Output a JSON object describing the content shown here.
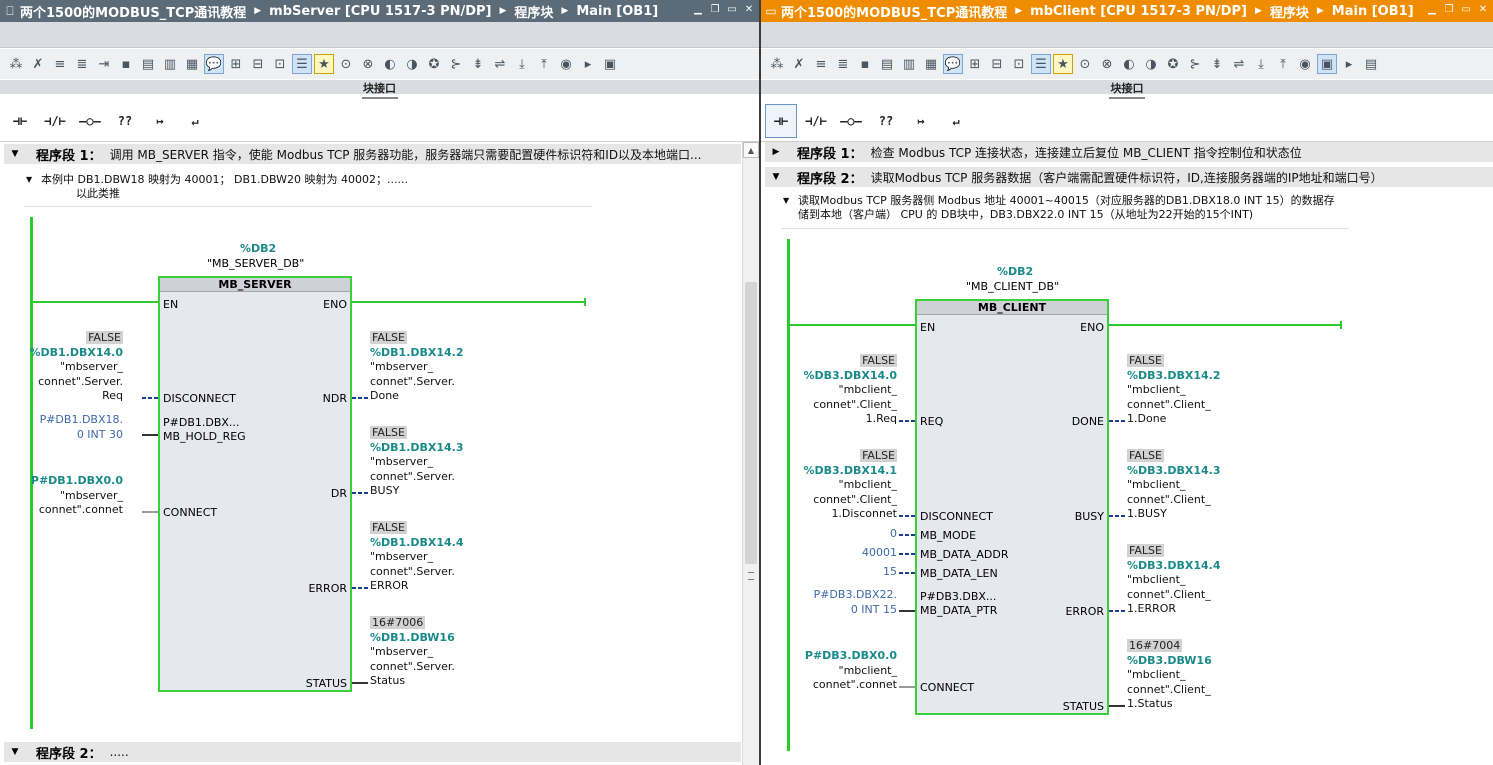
{
  "colors": {
    "left_title_bg": "#5b6b78",
    "right_title_bg": "#f08c00",
    "rail": "#2ccb2c",
    "block_border": "#39d039",
    "addr": "#1b8a8a",
    "const": "#3d6aa8"
  },
  "left": {
    "breadcrumb": [
      "两个1500的MODBUS_TCP通讯教程",
      "mbServer [CPU 1517-3 PN/DP]",
      "程序块",
      "Main [OB1]"
    ],
    "block_interface": "块接口",
    "favorites": [
      "⊣⊢",
      "⊣/⊢",
      "–○–",
      "??",
      "↦",
      "↵"
    ],
    "network1": {
      "title": "程序段 1：",
      "text": "调用 MB_SERVER 指令，使能 Modbus TCP 服务器功能，服务器端只需要配置硬件标识符和ID以及本地端口...",
      "comment_line1": "本例中 DB1.DBW18 映射为 40001； DB1.DBW20 映射为 40002；......",
      "comment_line2": "以此类推"
    },
    "block": {
      "db_addr": "%DB2",
      "db_name": "\"MB_SERVER_DB\"",
      "type": "MB_SERVER",
      "pins": {
        "en": "EN",
        "eno": "ENO",
        "disconnect": "DISCONNECT",
        "hold_reg_val": "P#DB1.DBX...",
        "hold_reg": "MB_HOLD_REG",
        "connect": "CONNECT",
        "ndr": "NDR",
        "dr": "DR",
        "error": "ERROR",
        "status": "STATUS"
      }
    },
    "in_disconnect": {
      "value": "FALSE",
      "addr": "%DB1.DBX14.0",
      "sym1": "\"mbserver_",
      "sym2": "connet\".Server.",
      "sym3": "Req"
    },
    "in_hold_reg": {
      "line1": "P#DB1.DBX18.",
      "line2": "0 INT 30"
    },
    "in_connect": {
      "addr": "P#DB1.DBX0.0",
      "sym1": "\"mbserver_",
      "sym2": "connet\".connet"
    },
    "out_ndr": {
      "value": "FALSE",
      "addr": "%DB1.DBX14.2",
      "sym1": "\"mbserver_",
      "sym2": "connet\".Server.",
      "sym3": "Done"
    },
    "out_dr": {
      "value": "FALSE",
      "addr": "%DB1.DBX14.3",
      "sym1": "\"mbserver_",
      "sym2": "connet\".Server.",
      "sym3": "BUSY"
    },
    "out_error": {
      "value": "FALSE",
      "addr": "%DB1.DBX14.4",
      "sym1": "\"mbserver_",
      "sym2": "connet\".Server.",
      "sym3": "ERROR"
    },
    "out_status": {
      "value": "16#7006",
      "addr": "%DB1.DBW16",
      "sym1": "\"mbserver_",
      "sym2": "connet\".Server.",
      "sym3": "Status"
    },
    "network2": {
      "title": "程序段 2：",
      "text": "....."
    }
  },
  "right": {
    "breadcrumb": [
      "两个1500的MODBUS_TCP通讯教程",
      "mbClient [CPU 1517-3 PN/DP]",
      "程序块",
      "Main [OB1]"
    ],
    "block_interface": "块接口",
    "favorites": [
      "⊣⊢",
      "⊣/⊢",
      "–○–",
      "??",
      "↦",
      "↵"
    ],
    "network1": {
      "title": "程序段 1：",
      "text": "检查 Modbus TCP 连接状态，连接建立后复位 MB_CLIENT 指令控制位和状态位"
    },
    "network2": {
      "title": "程序段 2：",
      "text": "读取Modbus TCP 服务器数据（客户端需配置硬件标识符，ID,连接服务器端的IP地址和端口号）",
      "comment_line1": "读取Modbus TCP 服务器侧 Modbus 地址 40001~40015（对应服务器的DB1.DBX18.0 INT 15）的数据存",
      "comment_line2": "储到本地（客户端） CPU 的 DB块中，DB3.DBX22.0 INT 15（从地址为22开始的15个INT)"
    },
    "block": {
      "db_addr": "%DB2",
      "db_name": "\"MB_CLIENT_DB\"",
      "type": "MB_CLIENT",
      "pins": {
        "en": "EN",
        "eno": "ENO",
        "req": "REQ",
        "disconnect": "DISCONNECT",
        "mode": "MB_MODE",
        "data_addr": "MB_DATA_ADDR",
        "data_len": "MB_DATA_LEN",
        "data_ptr_val": "P#DB3.DBX...",
        "data_ptr": "MB_DATA_PTR",
        "connect": "CONNECT",
        "done": "DONE",
        "busy": "BUSY",
        "error": "ERROR",
        "status": "STATUS"
      }
    },
    "in_req": {
      "value": "FALSE",
      "addr": "%DB3.DBX14.0",
      "sym1": "\"mbclient_",
      "sym2": "connet\".Client_",
      "sym3": "1.Req"
    },
    "in_disconnect": {
      "value": "FALSE",
      "addr": "%DB3.DBX14.1",
      "sym1": "\"mbclient_",
      "sym2": "connet\".Client_",
      "sym3": "1.Disconnet"
    },
    "in_mode": "0",
    "in_data_addr": "40001",
    "in_data_len": "15",
    "in_data_ptr": {
      "line1": "P#DB3.DBX22.",
      "line2": "0 INT 15"
    },
    "in_connect": {
      "addr": "P#DB3.DBX0.0",
      "sym1": "\"mbclient_",
      "sym2": "connet\".connet"
    },
    "out_done": {
      "value": "FALSE",
      "addr": "%DB3.DBX14.2",
      "sym1": "\"mbclient_",
      "sym2": "connet\".Client_",
      "sym3": "1.Done"
    },
    "out_busy": {
      "value": "FALSE",
      "addr": "%DB3.DBX14.3",
      "sym1": "\"mbclient_",
      "sym2": "connet\".Client_",
      "sym3": "1.BUSY"
    },
    "out_error": {
      "value": "FALSE",
      "addr": "%DB3.DBX14.4",
      "sym1": "\"mbclient_",
      "sym2": "connet\".Client_",
      "sym3": "1.ERROR"
    },
    "out_status": {
      "value": "16#7004",
      "addr": "%DB3.DBW16",
      "sym1": "\"mbclient_",
      "sym2": "connet\".Client_",
      "sym3": "1.Status"
    }
  }
}
